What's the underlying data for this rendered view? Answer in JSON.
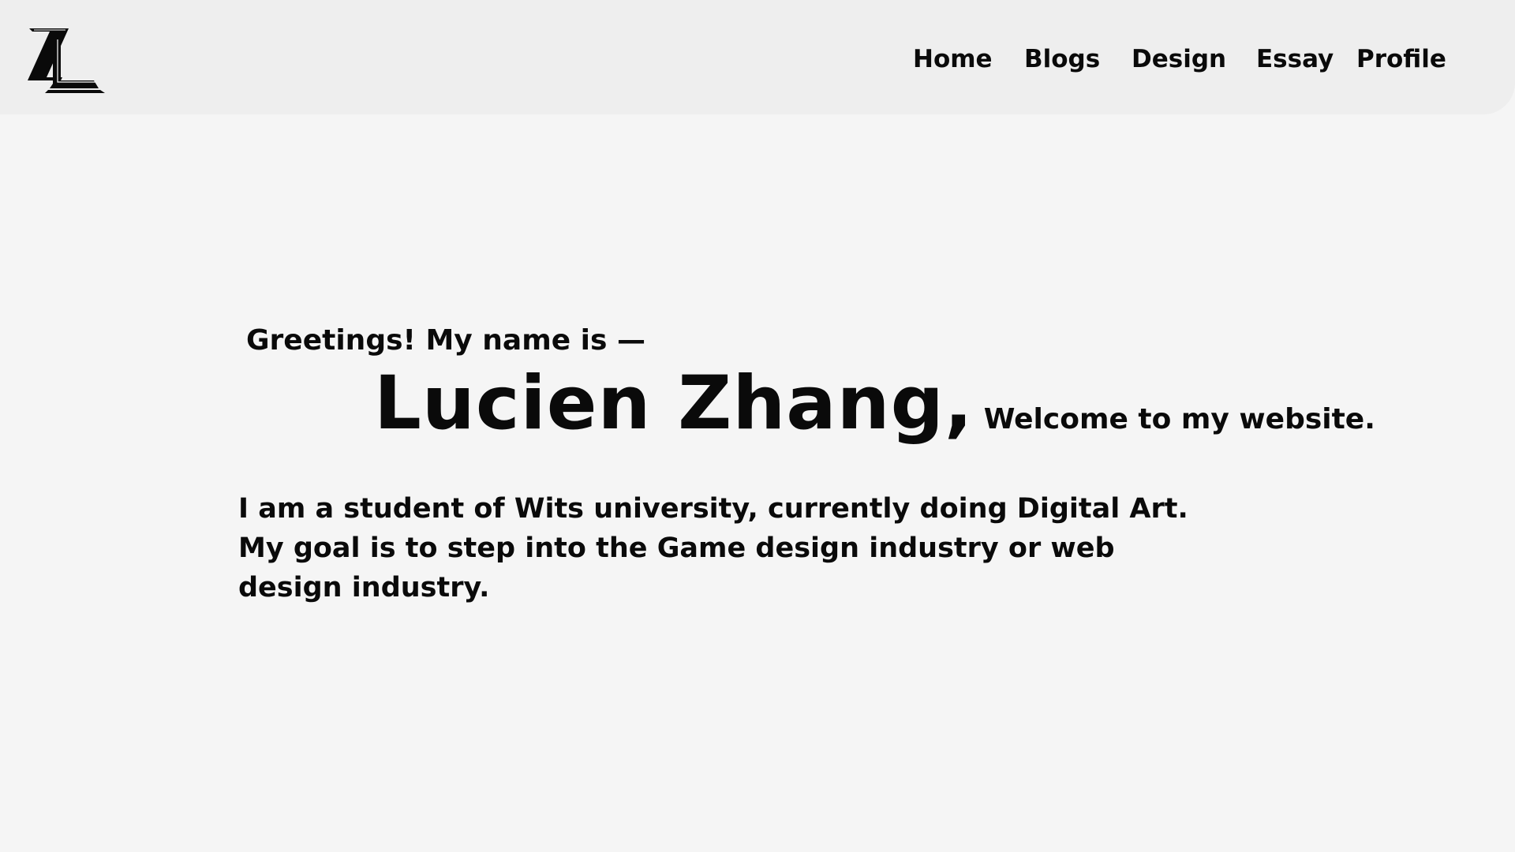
{
  "header": {
    "logo": {
      "text": "ZL",
      "icon": "zl-monogram-logo"
    },
    "nav": [
      {
        "label": "Home"
      },
      {
        "label": "Blogs"
      },
      {
        "label": "Design"
      },
      {
        "label": "Essay"
      },
      {
        "label": "Profile"
      }
    ]
  },
  "hero": {
    "greeting": "Greetings! My name is —",
    "name": "Lucien Zhang,",
    "welcome": "Welcome to my website.",
    "bio_lines": [
      "I am a student of Wits university, currently doing Digital Art.",
      "My goal is to step into the Game design industry or web",
      "design industry."
    ]
  },
  "colors": {
    "background": "#f5f5f5",
    "header_background": "#eeeeee",
    "text": "#0a0a0a"
  }
}
